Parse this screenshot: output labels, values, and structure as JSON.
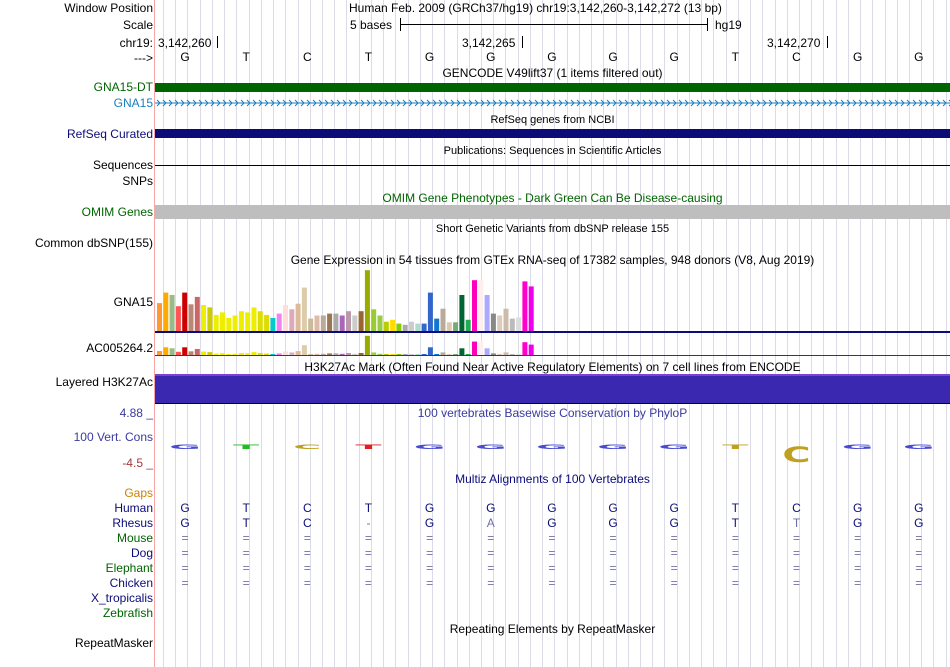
{
  "header": {
    "window_position_label": "Window Position",
    "window_position_value": "Human Feb. 2009 (GRCh37/hg19)   chr19:3,142,260-3,142,272 (13 bp)",
    "scale_label": "Scale",
    "scale_value": "5 bases",
    "scale_db": "hg19",
    "chrom_label": "chr19:",
    "arrow_label": "--->",
    "coords": [
      "3,142,260",
      "3,142,265",
      "3,142,270"
    ]
  },
  "sequence": [
    "G",
    "T",
    "C",
    "T",
    "G",
    "G",
    "G",
    "G",
    "G",
    "T",
    "C",
    "G",
    "G"
  ],
  "tracks": {
    "gencode_title": "GENCODE V49lift37 (1 items filtered out)",
    "gencode_items": [
      "GNA15-DT",
      "GNA15"
    ],
    "refseq_title": "RefSeq genes from NCBI",
    "refseq_label": "RefSeq Curated",
    "pubs_title": "Publications: Sequences in Scientific Articles",
    "pubs_label": "Sequences",
    "snps_label": "SNPs",
    "omim_title": "OMIM Gene Phenotypes - Dark Green Can Be Disease-causing",
    "omim_label": "OMIM Genes",
    "dbsnp_title": "Short Genetic Variants from dbSNP release 155",
    "dbsnp_label": "Common dbSNP(155)",
    "gtex_title": "Gene Expression in 54 tissues from GTEx RNA-seq of 17382 samples, 948 donors (V8, Aug 2019)",
    "gtex_gene1": "GNA15",
    "gtex_gene2": "AC005264.2",
    "h3k27_title": "H3K27Ac Mark (Often Found Near Active Regulatory Elements) on 7 cell lines from ENCODE",
    "h3k27_label": "Layered H3K27Ac",
    "phylop_title": "100 vertebrates Basewise Conservation by PhyloP",
    "phylop_label": "100 Vert. Cons",
    "phylop_max": "4.88 _",
    "phylop_min": "-4.5 _",
    "multiz_title": "Multiz Alignments of 100 Vertebrates",
    "repeat_title": "Repeating Elements by RepeatMasker",
    "repeat_label": "RepeatMasker"
  },
  "alignment": {
    "gaps_label": "Gaps",
    "species": [
      {
        "name": "Human",
        "bases": [
          "G",
          "T",
          "C",
          "T",
          "G",
          "G",
          "G",
          "G",
          "G",
          "T",
          "C",
          "G",
          "G"
        ]
      },
      {
        "name": "Rhesus",
        "bases": [
          "G",
          "T",
          "C",
          "-",
          "G",
          "A",
          "G",
          "G",
          "G",
          "T",
          "T",
          "G",
          "G"
        ]
      },
      {
        "name": "Mouse",
        "bases": [
          "=",
          "=",
          "=",
          "=",
          "=",
          "=",
          "=",
          "=",
          "=",
          "=",
          "=",
          "=",
          "="
        ]
      },
      {
        "name": "Dog",
        "bases": [
          "=",
          "=",
          "=",
          "=",
          "=",
          "=",
          "=",
          "=",
          "=",
          "=",
          "=",
          "=",
          "="
        ]
      },
      {
        "name": "Elephant",
        "bases": [
          "=",
          "=",
          "=",
          "=",
          "=",
          "=",
          "=",
          "=",
          "=",
          "=",
          "=",
          "=",
          "="
        ]
      },
      {
        "name": "Chicken",
        "bases": [
          "=",
          "=",
          "=",
          "=",
          "=",
          "=",
          "=",
          "=",
          "=",
          "=",
          "=",
          "=",
          "="
        ]
      },
      {
        "name": "X_tropicalis",
        "bases": []
      },
      {
        "name": "Zebrafish",
        "bases": []
      }
    ]
  },
  "gtex_values": [
    0.45,
    0.62,
    0.58,
    0.4,
    0.62,
    0.43,
    0.55,
    0.42,
    0.38,
    0.26,
    0.3,
    0.21,
    0.25,
    0.32,
    0.3,
    0.38,
    0.32,
    0.26,
    0.21,
    0.28,
    0.42,
    0.35,
    0.44,
    0.7,
    0.2,
    0.25,
    0.25,
    0.28,
    0.28,
    0.25,
    0.32,
    0.25,
    0.32,
    0.98,
    0.35,
    0.25,
    0.15,
    0.18,
    0.12,
    0.1,
    0.15,
    0.12,
    0.12,
    0.62,
    0.2,
    0.36,
    0.14,
    0.14,
    0.58,
    0.18,
    0.82,
    0.82,
    0.58,
    0.28,
    0.25,
    0.36,
    0.2,
    0.22,
    0.8,
    0.72
  ],
  "gtex_colors": [
    "#FF9933",
    "#FFAA00",
    "#99BB88",
    "#FF5555",
    "#CC0000",
    "#BB8877",
    "#CC6666",
    "#EEEE00",
    "#CCCC00",
    "#EEEE00",
    "#EEEE00",
    "#EEEE00",
    "#EEEE00",
    "#EEEE00",
    "#EEEE00",
    "#EEEE00",
    "#DDDD00",
    "#DDDD00",
    "#00CCCC",
    "#EE82EE",
    "#FFDDDD",
    "#DDAABB",
    "#DDBB99",
    "#DDCCAA",
    "#CCBB99",
    "#DDBBAA",
    "#BBAA99",
    "#997755",
    "#AAAAAA",
    "#AA66BB",
    "#BB99AA",
    "#CCCCCC",
    "#996633",
    "#99AA00",
    "#99CC33",
    "#99CC44",
    "#BBCC00",
    "#FFDD00",
    "#88CC00",
    "#AAAAAA",
    "#CCCCCC",
    "#AADDCC",
    "#3366CC",
    "#3366CC",
    "#1177CC",
    "#BBAA99",
    "#DDC9B0",
    "#77AA77",
    "#006633",
    "#22AA55",
    "#FF00BB",
    "#FFEEEE",
    "#AAAAFF",
    "#888888",
    "#DDCCBB",
    "#CCBBAA",
    "#BBBBBB",
    "#DDDDDD",
    "#FF00CC",
    "#EE00EE"
  ],
  "colors": {
    "gencode_dt": "#006400",
    "gencode": "#1a7fbf",
    "refseq": "#0c0c78",
    "omim": "#bebebe",
    "h3k27": "#3a28b0",
    "label_navy": "#0c0c78",
    "label_green": "#006400",
    "label_orange": "#d08000",
    "phylop_max": "#3a3aa0",
    "phylop_min": "#a03a3a"
  }
}
